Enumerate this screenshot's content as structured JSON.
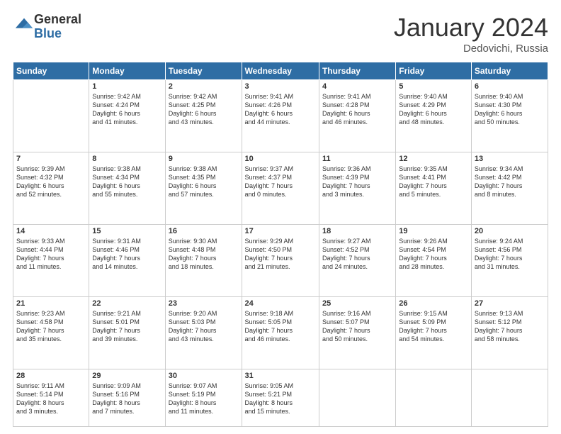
{
  "header": {
    "logo_general": "General",
    "logo_blue": "Blue",
    "month": "January 2024",
    "location": "Dedovichi, Russia"
  },
  "weekdays": [
    "Sunday",
    "Monday",
    "Tuesday",
    "Wednesday",
    "Thursday",
    "Friday",
    "Saturday"
  ],
  "weeks": [
    [
      {
        "day": "",
        "info": ""
      },
      {
        "day": "1",
        "info": "Sunrise: 9:42 AM\nSunset: 4:24 PM\nDaylight: 6 hours\nand 41 minutes."
      },
      {
        "day": "2",
        "info": "Sunrise: 9:42 AM\nSunset: 4:25 PM\nDaylight: 6 hours\nand 43 minutes."
      },
      {
        "day": "3",
        "info": "Sunrise: 9:41 AM\nSunset: 4:26 PM\nDaylight: 6 hours\nand 44 minutes."
      },
      {
        "day": "4",
        "info": "Sunrise: 9:41 AM\nSunset: 4:28 PM\nDaylight: 6 hours\nand 46 minutes."
      },
      {
        "day": "5",
        "info": "Sunrise: 9:40 AM\nSunset: 4:29 PM\nDaylight: 6 hours\nand 48 minutes."
      },
      {
        "day": "6",
        "info": "Sunrise: 9:40 AM\nSunset: 4:30 PM\nDaylight: 6 hours\nand 50 minutes."
      }
    ],
    [
      {
        "day": "7",
        "info": "Sunrise: 9:39 AM\nSunset: 4:32 PM\nDaylight: 6 hours\nand 52 minutes."
      },
      {
        "day": "8",
        "info": "Sunrise: 9:38 AM\nSunset: 4:34 PM\nDaylight: 6 hours\nand 55 minutes."
      },
      {
        "day": "9",
        "info": "Sunrise: 9:38 AM\nSunset: 4:35 PM\nDaylight: 6 hours\nand 57 minutes."
      },
      {
        "day": "10",
        "info": "Sunrise: 9:37 AM\nSunset: 4:37 PM\nDaylight: 7 hours\nand 0 minutes."
      },
      {
        "day": "11",
        "info": "Sunrise: 9:36 AM\nSunset: 4:39 PM\nDaylight: 7 hours\nand 3 minutes."
      },
      {
        "day": "12",
        "info": "Sunrise: 9:35 AM\nSunset: 4:41 PM\nDaylight: 7 hours\nand 5 minutes."
      },
      {
        "day": "13",
        "info": "Sunrise: 9:34 AM\nSunset: 4:42 PM\nDaylight: 7 hours\nand 8 minutes."
      }
    ],
    [
      {
        "day": "14",
        "info": "Sunrise: 9:33 AM\nSunset: 4:44 PM\nDaylight: 7 hours\nand 11 minutes."
      },
      {
        "day": "15",
        "info": "Sunrise: 9:31 AM\nSunset: 4:46 PM\nDaylight: 7 hours\nand 14 minutes."
      },
      {
        "day": "16",
        "info": "Sunrise: 9:30 AM\nSunset: 4:48 PM\nDaylight: 7 hours\nand 18 minutes."
      },
      {
        "day": "17",
        "info": "Sunrise: 9:29 AM\nSunset: 4:50 PM\nDaylight: 7 hours\nand 21 minutes."
      },
      {
        "day": "18",
        "info": "Sunrise: 9:27 AM\nSunset: 4:52 PM\nDaylight: 7 hours\nand 24 minutes."
      },
      {
        "day": "19",
        "info": "Sunrise: 9:26 AM\nSunset: 4:54 PM\nDaylight: 7 hours\nand 28 minutes."
      },
      {
        "day": "20",
        "info": "Sunrise: 9:24 AM\nSunset: 4:56 PM\nDaylight: 7 hours\nand 31 minutes."
      }
    ],
    [
      {
        "day": "21",
        "info": "Sunrise: 9:23 AM\nSunset: 4:58 PM\nDaylight: 7 hours\nand 35 minutes."
      },
      {
        "day": "22",
        "info": "Sunrise: 9:21 AM\nSunset: 5:01 PM\nDaylight: 7 hours\nand 39 minutes."
      },
      {
        "day": "23",
        "info": "Sunrise: 9:20 AM\nSunset: 5:03 PM\nDaylight: 7 hours\nand 43 minutes."
      },
      {
        "day": "24",
        "info": "Sunrise: 9:18 AM\nSunset: 5:05 PM\nDaylight: 7 hours\nand 46 minutes."
      },
      {
        "day": "25",
        "info": "Sunrise: 9:16 AM\nSunset: 5:07 PM\nDaylight: 7 hours\nand 50 minutes."
      },
      {
        "day": "26",
        "info": "Sunrise: 9:15 AM\nSunset: 5:09 PM\nDaylight: 7 hours\nand 54 minutes."
      },
      {
        "day": "27",
        "info": "Sunrise: 9:13 AM\nSunset: 5:12 PM\nDaylight: 7 hours\nand 58 minutes."
      }
    ],
    [
      {
        "day": "28",
        "info": "Sunrise: 9:11 AM\nSunset: 5:14 PM\nDaylight: 8 hours\nand 3 minutes."
      },
      {
        "day": "29",
        "info": "Sunrise: 9:09 AM\nSunset: 5:16 PM\nDaylight: 8 hours\nand 7 minutes."
      },
      {
        "day": "30",
        "info": "Sunrise: 9:07 AM\nSunset: 5:19 PM\nDaylight: 8 hours\nand 11 minutes."
      },
      {
        "day": "31",
        "info": "Sunrise: 9:05 AM\nSunset: 5:21 PM\nDaylight: 8 hours\nand 15 minutes."
      },
      {
        "day": "",
        "info": ""
      },
      {
        "day": "",
        "info": ""
      },
      {
        "day": "",
        "info": ""
      }
    ]
  ]
}
